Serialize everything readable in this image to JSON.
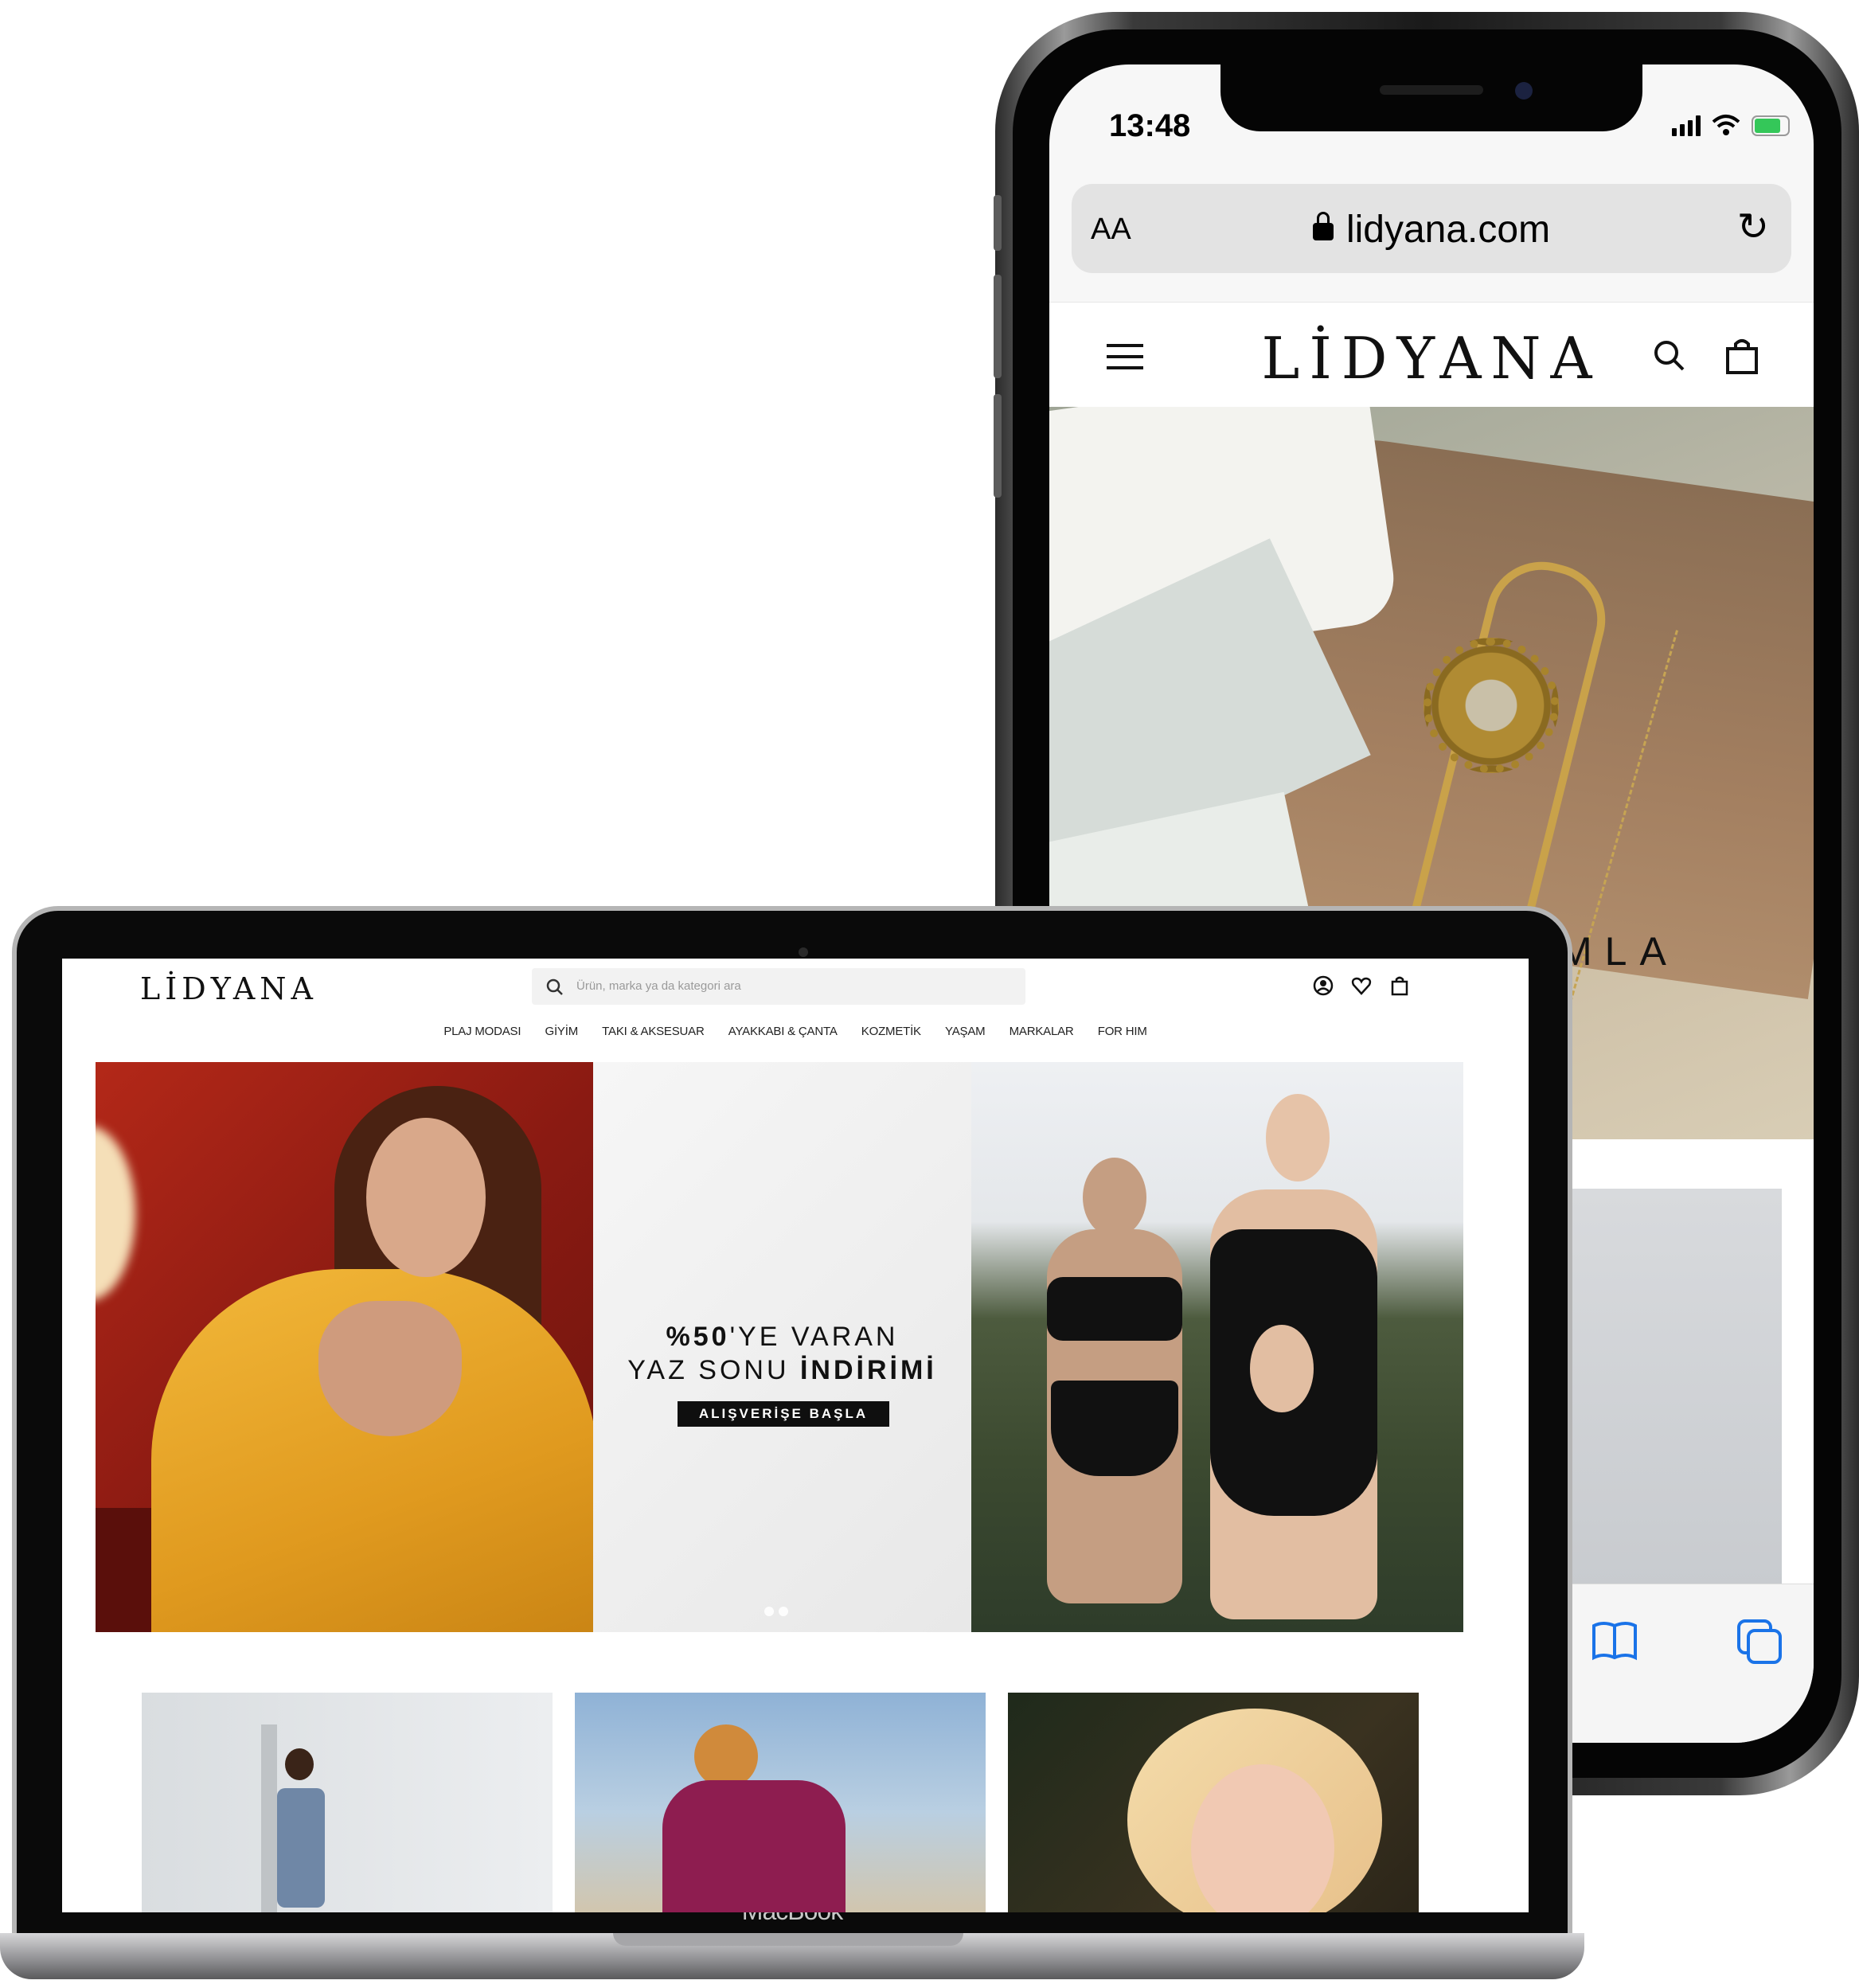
{
  "phone": {
    "status_time": "13:48",
    "browser": {
      "text_size_label": "AA",
      "url": "lidyana.com",
      "reload_icon": "reload-icon"
    },
    "site": {
      "logo": "LİDYANA",
      "hero_text": "MLA"
    },
    "icons": [
      "menu-icon",
      "search-icon",
      "bag-icon",
      "bookmarks-icon",
      "tabs-icon",
      "wifi-icon",
      "signal-icon",
      "battery-icon",
      "lock-icon"
    ],
    "battery_charging": true
  },
  "laptop": {
    "brand": "MacBook",
    "site": {
      "logo": "LİDYANA",
      "search_placeholder": "Ürün, marka ya da kategori ara",
      "nav": [
        "PLAJ MODASI",
        "GİYİM",
        "TAKI & AKSESUAR",
        "AYAKKABI & ÇANTA",
        "KOZMETİK",
        "YAŞAM",
        "MARKALAR",
        "FOR HIM"
      ],
      "hero": {
        "line1_bold": "%50",
        "line1_rest": "'YE VARAN",
        "line2_rest": "YAZ SONU ",
        "line2_bold": "İNDİRİMİ",
        "cta": "ALIŞVERİŞE BAŞLA",
        "slides": 2
      },
      "header_icons": [
        "account-icon",
        "heart-icon",
        "cart-icon"
      ]
    }
  },
  "colors": {
    "promo_button": "#0f0f0f",
    "ios_blue": "#1a73e8",
    "battery_green": "#34c759"
  }
}
